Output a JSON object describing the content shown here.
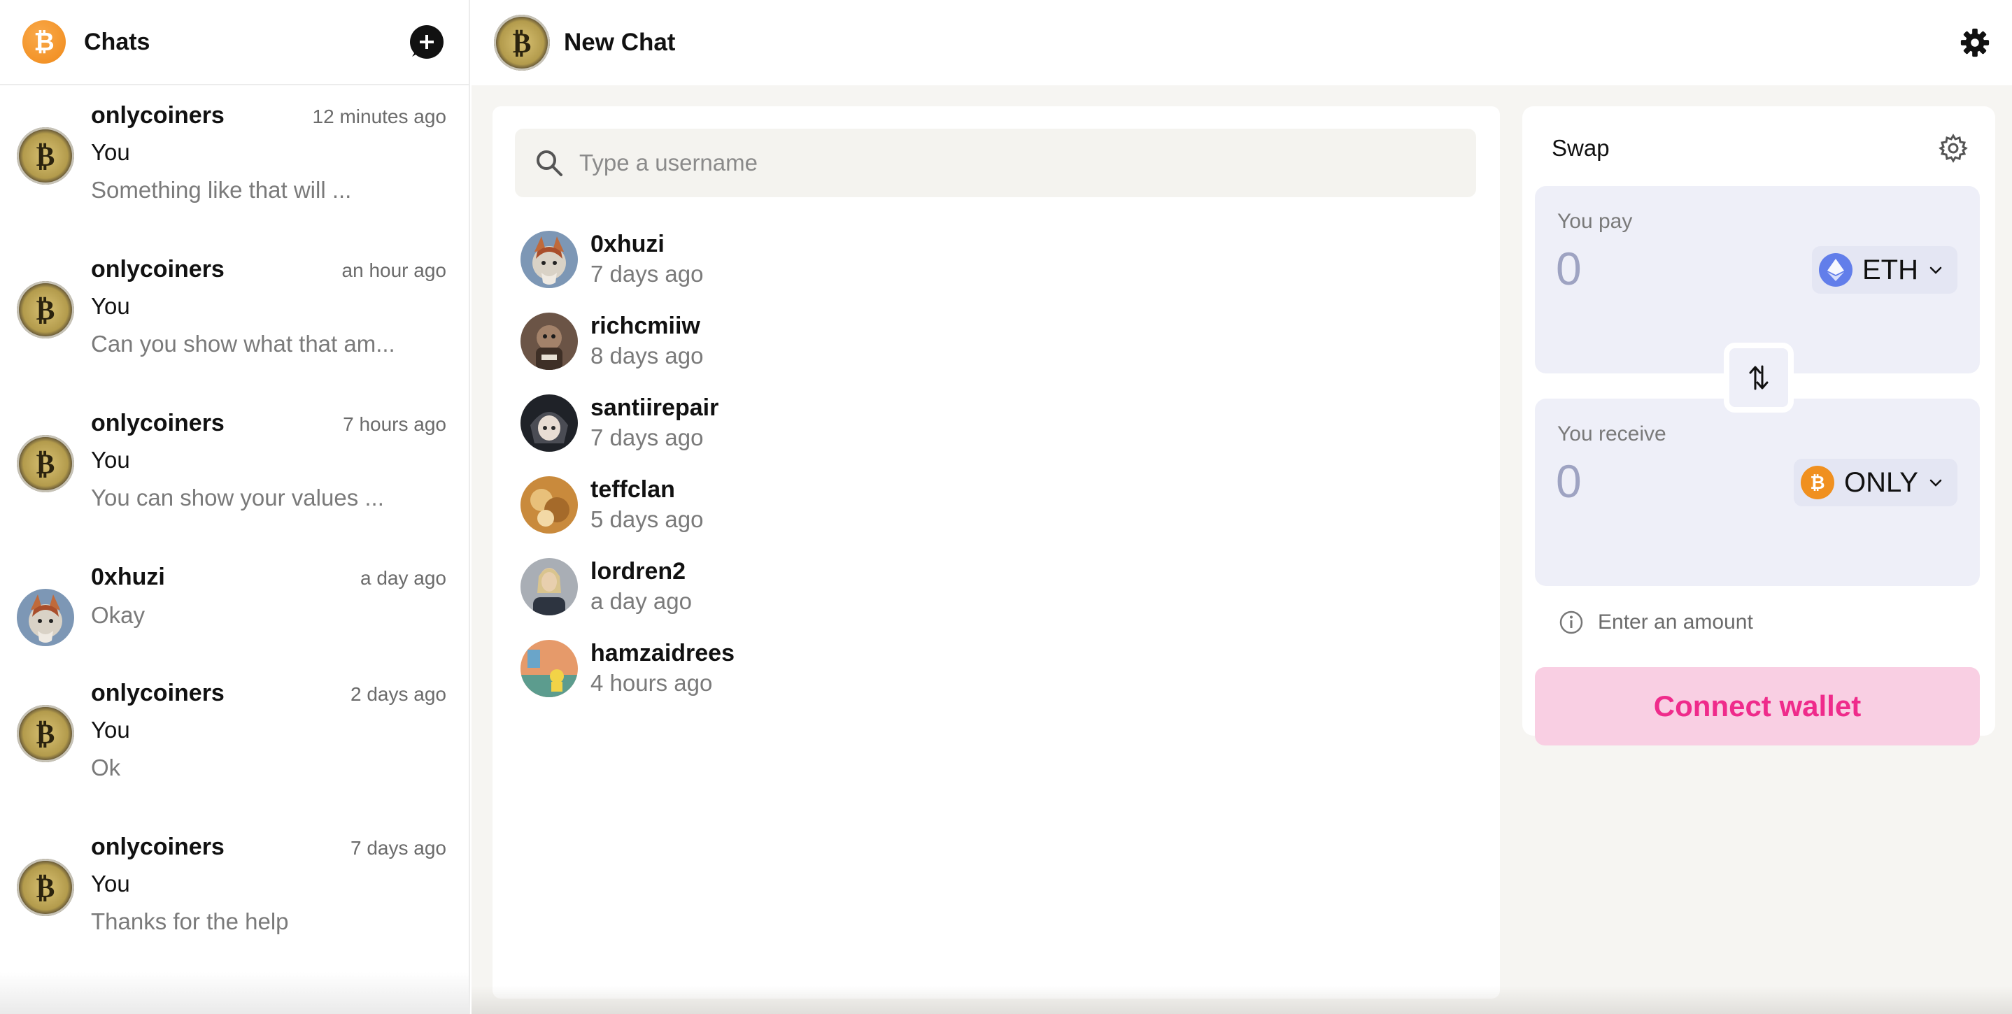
{
  "sidebar": {
    "title": "Chats",
    "logo_glyph": "₿",
    "new_chat_icon": "plus-chat-icon",
    "chats": [
      {
        "name": "onlycoiners",
        "time": "12 minutes ago",
        "sender": "You",
        "preview": "Something like that will ..."
      },
      {
        "name": "onlycoiners",
        "time": "an hour ago",
        "sender": "You",
        "preview": "Can you show what that am..."
      },
      {
        "name": "onlycoiners",
        "time": "7 hours ago",
        "sender": "You",
        "preview": "You can show your values ..."
      },
      {
        "name": "0xhuzi",
        "time": "a day ago",
        "sender": "",
        "preview": "Okay"
      },
      {
        "name": "onlycoiners",
        "time": "2 days ago",
        "sender": "You",
        "preview": "Ok"
      },
      {
        "name": "onlycoiners",
        "time": "7 days ago",
        "sender": "You",
        "preview": "Thanks for the help"
      }
    ]
  },
  "header": {
    "title": "New Chat",
    "settings_icon": "gear-icon"
  },
  "search": {
    "placeholder": "Type a username"
  },
  "users": [
    {
      "name": "0xhuzi",
      "time": "7 days ago"
    },
    {
      "name": "richcmiiw",
      "time": "8 days ago"
    },
    {
      "name": "santiirepair",
      "time": "7 days ago"
    },
    {
      "name": "teffclan",
      "time": "5 days ago"
    },
    {
      "name": "lordren2",
      "time": "a day ago"
    },
    {
      "name": "hamzaidrees",
      "time": "4 hours ago"
    }
  ],
  "swap": {
    "title": "Swap",
    "pay": {
      "label": "You pay",
      "amount": "0",
      "token": "ETH"
    },
    "receive": {
      "label": "You receive",
      "amount": "0",
      "token": "ONLY"
    },
    "info": "Enter an amount",
    "connect_label": "Connect wallet",
    "colors": {
      "accent": "#ef2b8b",
      "button_bg": "#f9cfe3",
      "card_bg": "#eeeff8"
    }
  }
}
